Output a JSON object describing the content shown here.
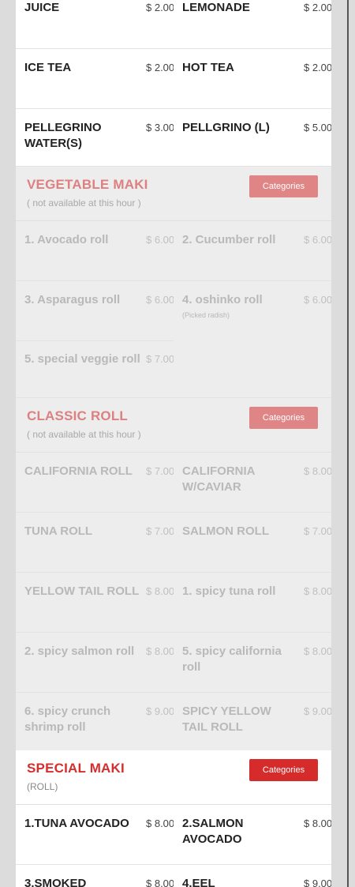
{
  "drinks": {
    "rows": [
      [
        {
          "name": "JUICE",
          "price": "$ 2.00"
        },
        {
          "name": "LEMONADE",
          "price": "$ 2.00"
        }
      ],
      [
        {
          "name": "ICE TEA",
          "price": "$ 2.00"
        },
        {
          "name": "HOT TEA",
          "price": "$ 2.00"
        }
      ],
      [
        {
          "name": "PELLEGRINO WATER(S)",
          "price": "$ 3.00"
        },
        {
          "name": "PELLGRINO (L)",
          "price": "$ 5.00"
        }
      ]
    ]
  },
  "vegetable_maki": {
    "title": "VEGETABLE MAKI",
    "note": "( not available at this hour )",
    "categories_label": "Categories",
    "rows": [
      [
        {
          "name": "1. Avocado roll",
          "price": "$ 6.00"
        },
        {
          "name": "2. Cucumber roll",
          "price": "$ 6.00"
        }
      ],
      [
        {
          "name": "3. Asparagus roll",
          "price": "$ 6.00"
        },
        {
          "name": "4. oshinko roll",
          "price": "$ 6.00",
          "desc": "(Picked radish)"
        }
      ],
      [
        {
          "name": "5. special veggie roll",
          "price": "$ 7.00"
        }
      ]
    ]
  },
  "classic_roll": {
    "title": "CLASSIC ROLL",
    "note": "( not available at this hour )",
    "categories_label": "Categories",
    "rows": [
      [
        {
          "name": "CALIFORNIA ROLL",
          "price": "$ 7.00"
        },
        {
          "name": "CALIFORNIA W/CAVIAR",
          "price": "$ 8.00"
        }
      ],
      [
        {
          "name": "TUNA ROLL",
          "price": "$ 7.00"
        },
        {
          "name": "SALMON ROLL",
          "price": "$ 7.00"
        }
      ],
      [
        {
          "name": "YELLOW TAIL ROLL",
          "price": "$ 8.00"
        },
        {
          "name": "1. spicy tuna roll",
          "price": "$ 8.00"
        }
      ],
      [
        {
          "name": "2. spicy salmon roll",
          "price": "$ 8.00"
        },
        {
          "name": "5. spicy california roll",
          "price": "$ 8.00"
        }
      ],
      [
        {
          "name": "6. spicy crunch shrimp roll",
          "price": "$ 9.00"
        },
        {
          "name": "SPICY YELLOW TAIL ROLL",
          "price": "$ 9.00"
        }
      ]
    ]
  },
  "special_maki": {
    "title": "SPECIAL MAKI",
    "note": "(ROLL)",
    "categories_label": "Categories",
    "rows": [
      [
        {
          "name": "1.TUNA AVOCADO",
          "price": "$ 8.00"
        },
        {
          "name": "2.SALMON AVOCADO",
          "price": "$ 8.00"
        }
      ],
      [
        {
          "name": "3.SMOKED",
          "price": "$ 8.00"
        },
        {
          "name": "4.EEL",
          "price": "$ 9.00"
        }
      ]
    ]
  },
  "colors": {
    "accent": "#d62b2b",
    "accent_faded": "#e08585",
    "unavailable_bg": "#ededed",
    "page_bg": "#dcdcdc"
  }
}
